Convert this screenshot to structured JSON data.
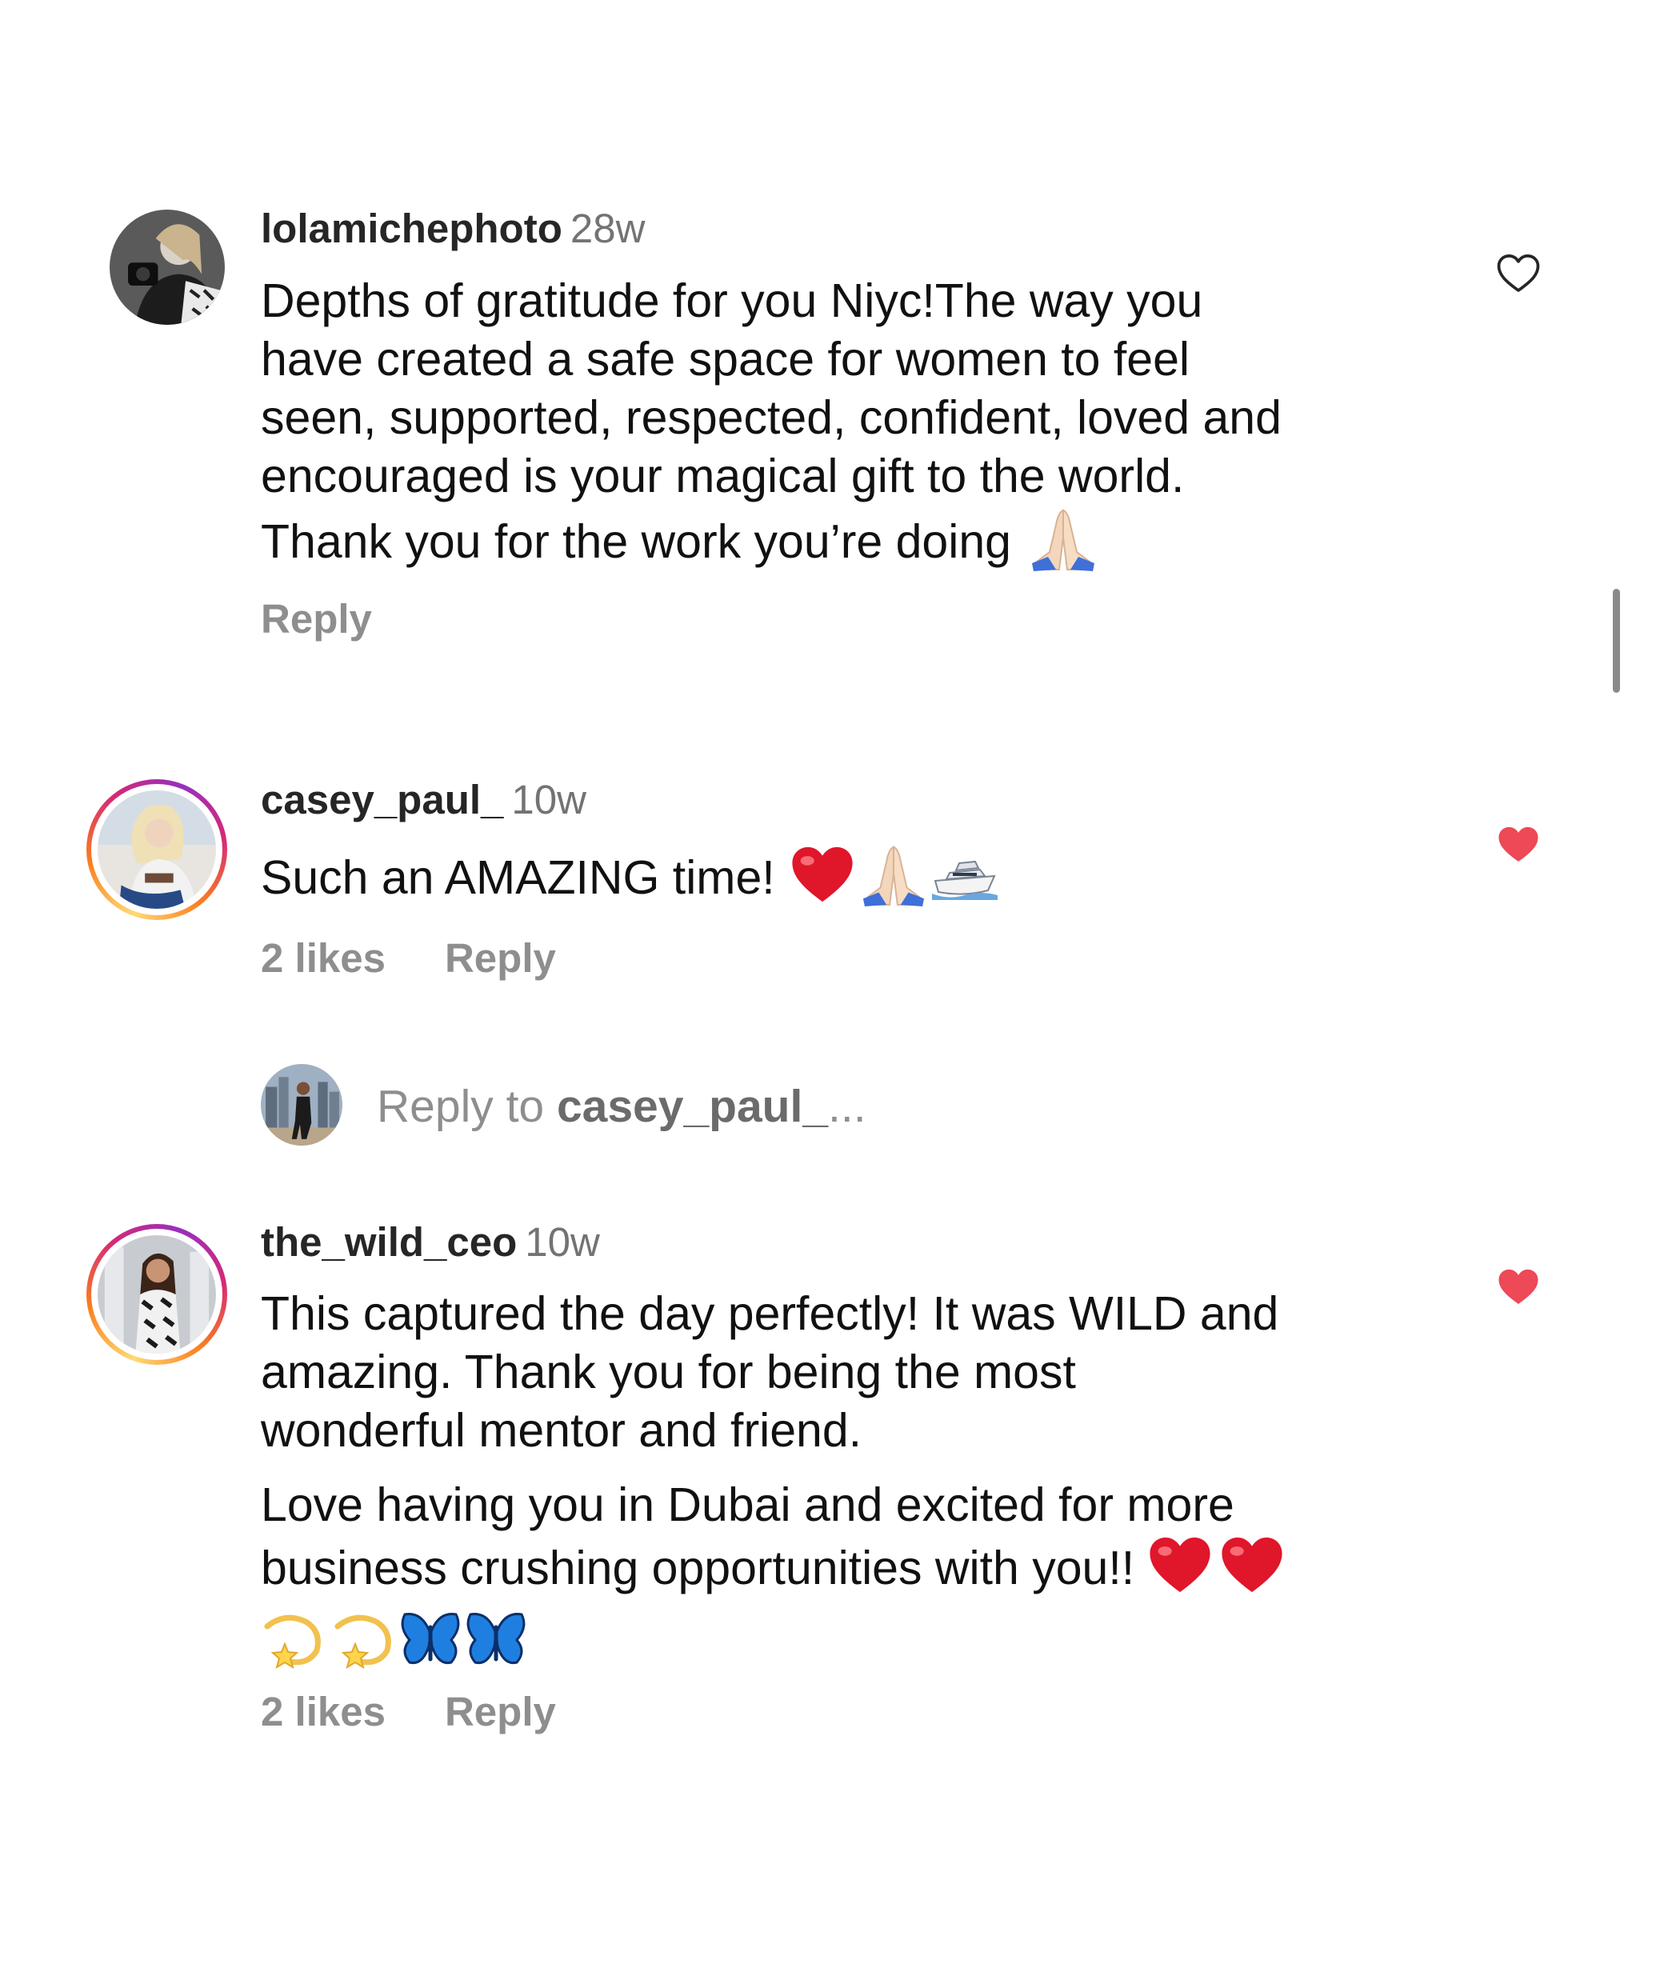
{
  "comments": [
    {
      "username": "lolamichephoto",
      "time": "28w",
      "lines": [
        "Depths of gratitude for you Niyc!The way you",
        "have created a safe space for women to feel",
        "seen, supported, respected, confident, loved and",
        "encouraged is your magical gift to the world.",
        "Thank you for the work you’re doing"
      ],
      "likes": "",
      "reply_label": "Reply",
      "liked": false,
      "icons": [
        "folded-hands-emoji",
        "heart-outline-icon"
      ]
    },
    {
      "username": "casey_paul_",
      "time": "10w",
      "lines": [
        "Such an AMAZING time!"
      ],
      "likes": "2 likes",
      "reply_label": "Reply",
      "liked": true,
      "icons": [
        "red-heart-emoji",
        "folded-hands-emoji",
        "ship-emoji",
        "heart-filled-icon"
      ]
    },
    {
      "username": "the_wild_ceo",
      "time": "10w",
      "lines": [
        "This captured the day perfectly! It was WILD and",
        "amazing. Thank you for being the most",
        "wonderful mentor and friend.",
        "Love having you in Dubai and excited for more",
        "business crushing opportunities with you!!"
      ],
      "likes": "2 likes",
      "reply_label": "Reply",
      "liked": true,
      "icons": [
        "red-heart-emoji",
        "dizzy-emoji",
        "butterfly-emoji",
        "heart-filled-icon"
      ]
    }
  ],
  "reply_input": {
    "prefix": "Reply to ",
    "target": "casey_paul_",
    "ellipsis": "..."
  },
  "colors": {
    "like_red": "#ed4956",
    "muted_gray": "#8e8e8e",
    "username_dark": "#262626"
  }
}
